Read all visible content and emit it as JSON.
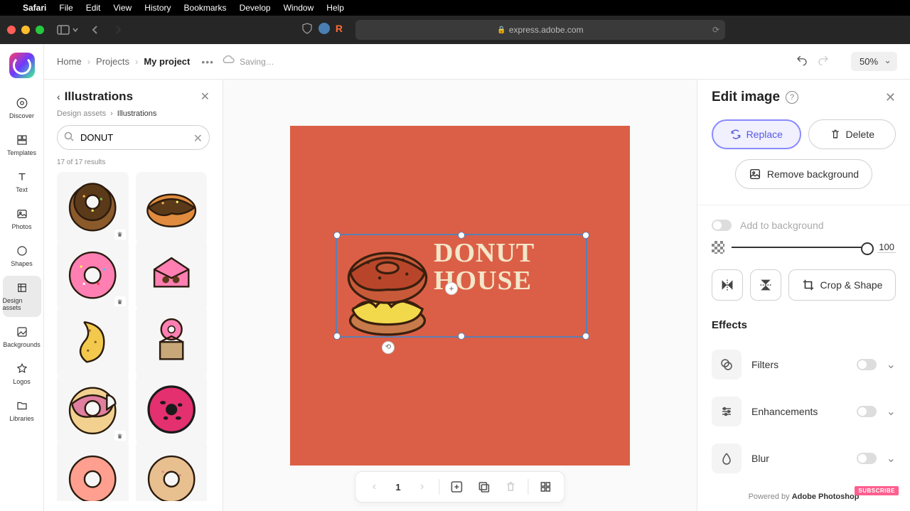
{
  "macos": {
    "app": "Safari",
    "menus": [
      "File",
      "Edit",
      "View",
      "History",
      "Bookmarks",
      "Develop",
      "Window",
      "Help"
    ]
  },
  "browser": {
    "url_display": "express.adobe.com"
  },
  "topbar": {
    "crumbs": [
      "Home",
      "Projects",
      "My project"
    ],
    "saving": "Saving…",
    "zoom": "50%"
  },
  "rail": {
    "items": [
      {
        "label": "Discover"
      },
      {
        "label": "Templates"
      },
      {
        "label": "Text"
      },
      {
        "label": "Photos"
      },
      {
        "label": "Shapes"
      },
      {
        "label": "Design assets"
      },
      {
        "label": "Backgrounds"
      },
      {
        "label": "Logos"
      },
      {
        "label": "Libraries"
      }
    ]
  },
  "assets": {
    "title": "Illustrations",
    "bc_root": "Design assets",
    "bc_current": "Illustrations",
    "search_value": "DONUT",
    "results_label": "17 of 17 results"
  },
  "canvas": {
    "text_line1": "DONUT",
    "text_line2": "HOUSE"
  },
  "bottombar": {
    "page": "1"
  },
  "right": {
    "title": "Edit image",
    "replace": "Replace",
    "delete": "Delete",
    "remove_bg": "Remove background",
    "add_bg": "Add to background",
    "opacity": "100",
    "crop": "Crop & Shape",
    "effects": "Effects",
    "effect_filters": "Filters",
    "effect_enhance": "Enhancements",
    "effect_blur": "Blur",
    "footer_prefix": "Powered by ",
    "footer_brand": "Adobe Photoshop",
    "subscribe": "SUBSCRIBE"
  }
}
